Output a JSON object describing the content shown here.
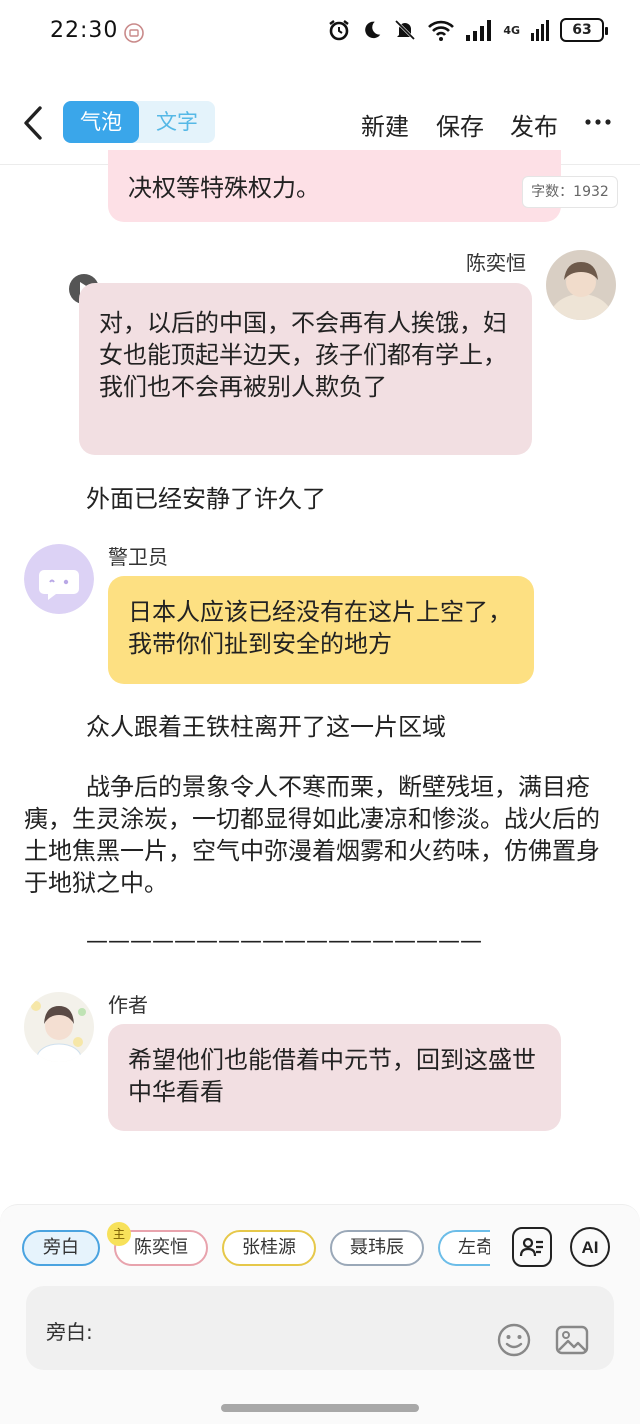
{
  "status": {
    "time": "22:30",
    "network": "4G",
    "battery": "63"
  },
  "nav": {
    "mode_bubble": "气泡",
    "mode_text": "文字",
    "new": "新建",
    "save": "保存",
    "publish": "发布"
  },
  "word_count": "字数：1932",
  "messages": {
    "top_bubble_text": "决权等特殊权力。",
    "chen_name": "陈奕恒",
    "chen_text": "对，以后的中国，不会再有人挨饿，妇女也能顶起半边天，孩子们都有学上，我们也不会再被别人欺负了",
    "narration1": "外面已经安静了许久了",
    "guard_name": "警卫员",
    "guard_text": "日本人应该已经没有在这片上空了，我带你们扯到安全的地方",
    "narration2": "众人跟着王铁柱离开了这一片区域",
    "narration3": "战争后的景象令人不寒而栗，断壁残垣，满目疮痍，生灵涂炭，一切都显得如此凄凉和惨淡。战火后的土地焦黑一片，空气中弥漫着烟雾和火药味，仿佛置身于地狱之中。",
    "separator": "——————————————————",
    "author_name": "作者",
    "author_text": "希望他们也能借着中元节，回到这盛世中华看看"
  },
  "roles": [
    {
      "label": "旁白",
      "color": "#4aa3e0"
    },
    {
      "label": "陈奕恒",
      "color": "#e8a3ad"
    },
    {
      "label": "张桂源",
      "color": "#e6c84a"
    },
    {
      "label": "聂玮辰",
      "color": "#9aa8b8"
    },
    {
      "label": "左奇",
      "color": "#6cbde8"
    }
  ],
  "main_badge": "主",
  "input": {
    "label": "旁白:"
  },
  "icons": [
    "back-icon",
    "more-icon",
    "play-icon",
    "alarm-icon",
    "moon-icon",
    "mute-icon",
    "wifi-icon",
    "signal-icon",
    "role-card-icon",
    "ai-icon",
    "emoji-icon",
    "image-icon"
  ]
}
